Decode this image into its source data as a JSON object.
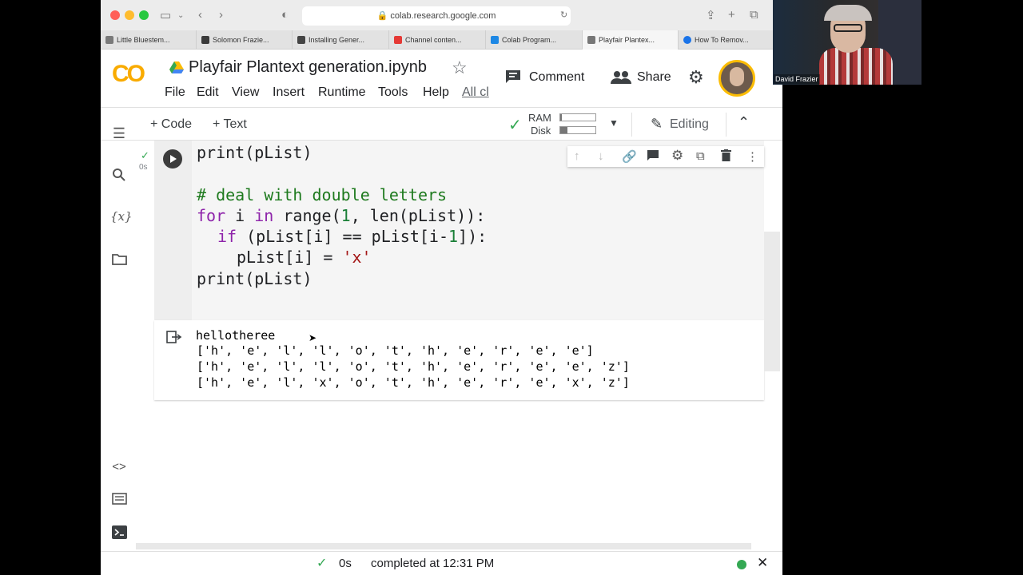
{
  "browser": {
    "url": "colab.research.google.com",
    "tabs": [
      {
        "label": "Little Bluestem...",
        "color": "#7a7a7a"
      },
      {
        "label": "Solomon Frazie...",
        "color": "#3a3a3a"
      },
      {
        "label": "Installing Gener...",
        "color": "#444444"
      },
      {
        "label": "Channel conten...",
        "color": "#e53935"
      },
      {
        "label": "Colab Program...",
        "color": "#1e88e5"
      },
      {
        "label": "Playfair Plantex...",
        "color": "#777777"
      },
      {
        "label": "How To Remov...",
        "color": "#1a73e8"
      }
    ],
    "active_tab": 5
  },
  "colab": {
    "logo": "CO",
    "title": "Playfair Plantext generation.ipynb",
    "menu": [
      "File",
      "Edit",
      "View",
      "Insert",
      "Runtime",
      "Tools",
      "Help",
      "All cl"
    ],
    "comment_label": "Comment",
    "share_label": "Share"
  },
  "toolbar": {
    "code_label": "+ Code",
    "text_label": "+ Text",
    "ram_label": "RAM",
    "disk_label": "Disk",
    "ram_fraction": 0.05,
    "disk_fraction": 0.2,
    "editing_label": "Editing"
  },
  "cell": {
    "exec_time": "0s",
    "lines": {
      "l1": "print(pList)",
      "l2": "# deal with double letters",
      "l3_kw1": "for",
      "l3_a": " i ",
      "l3_kw2": "in",
      "l3_b": " range(",
      "l3_n": "1",
      "l3_c": ", len(pList)):",
      "l4_kw": "if",
      "l4_a": " (pList[i] == pList[i-",
      "l4_n": "1",
      "l4_b": "]):",
      "l5_a": "pList[i] = ",
      "l5_s": "'x'",
      "l6": "print(pList)"
    }
  },
  "output": {
    "lines": [
      "hellotheree",
      "['h', 'e', 'l', 'l', 'o', 't', 'h', 'e', 'r', 'e', 'e']",
      "['h', 'e', 'l', 'l', 'o', 't', 'h', 'e', 'r', 'e', 'e', 'z']",
      "['h', 'e', 'l', 'x', 'o', 't', 'h', 'e', 'r', 'e', 'x', 'z']"
    ]
  },
  "status": {
    "time": "0s",
    "message": "completed at 12:31 PM"
  },
  "webcam": {
    "name": "David Frazier"
  },
  "colors": {
    "colab_orange": "#f9ab00",
    "check_green": "#34a853",
    "status_dot": "#34a853"
  }
}
